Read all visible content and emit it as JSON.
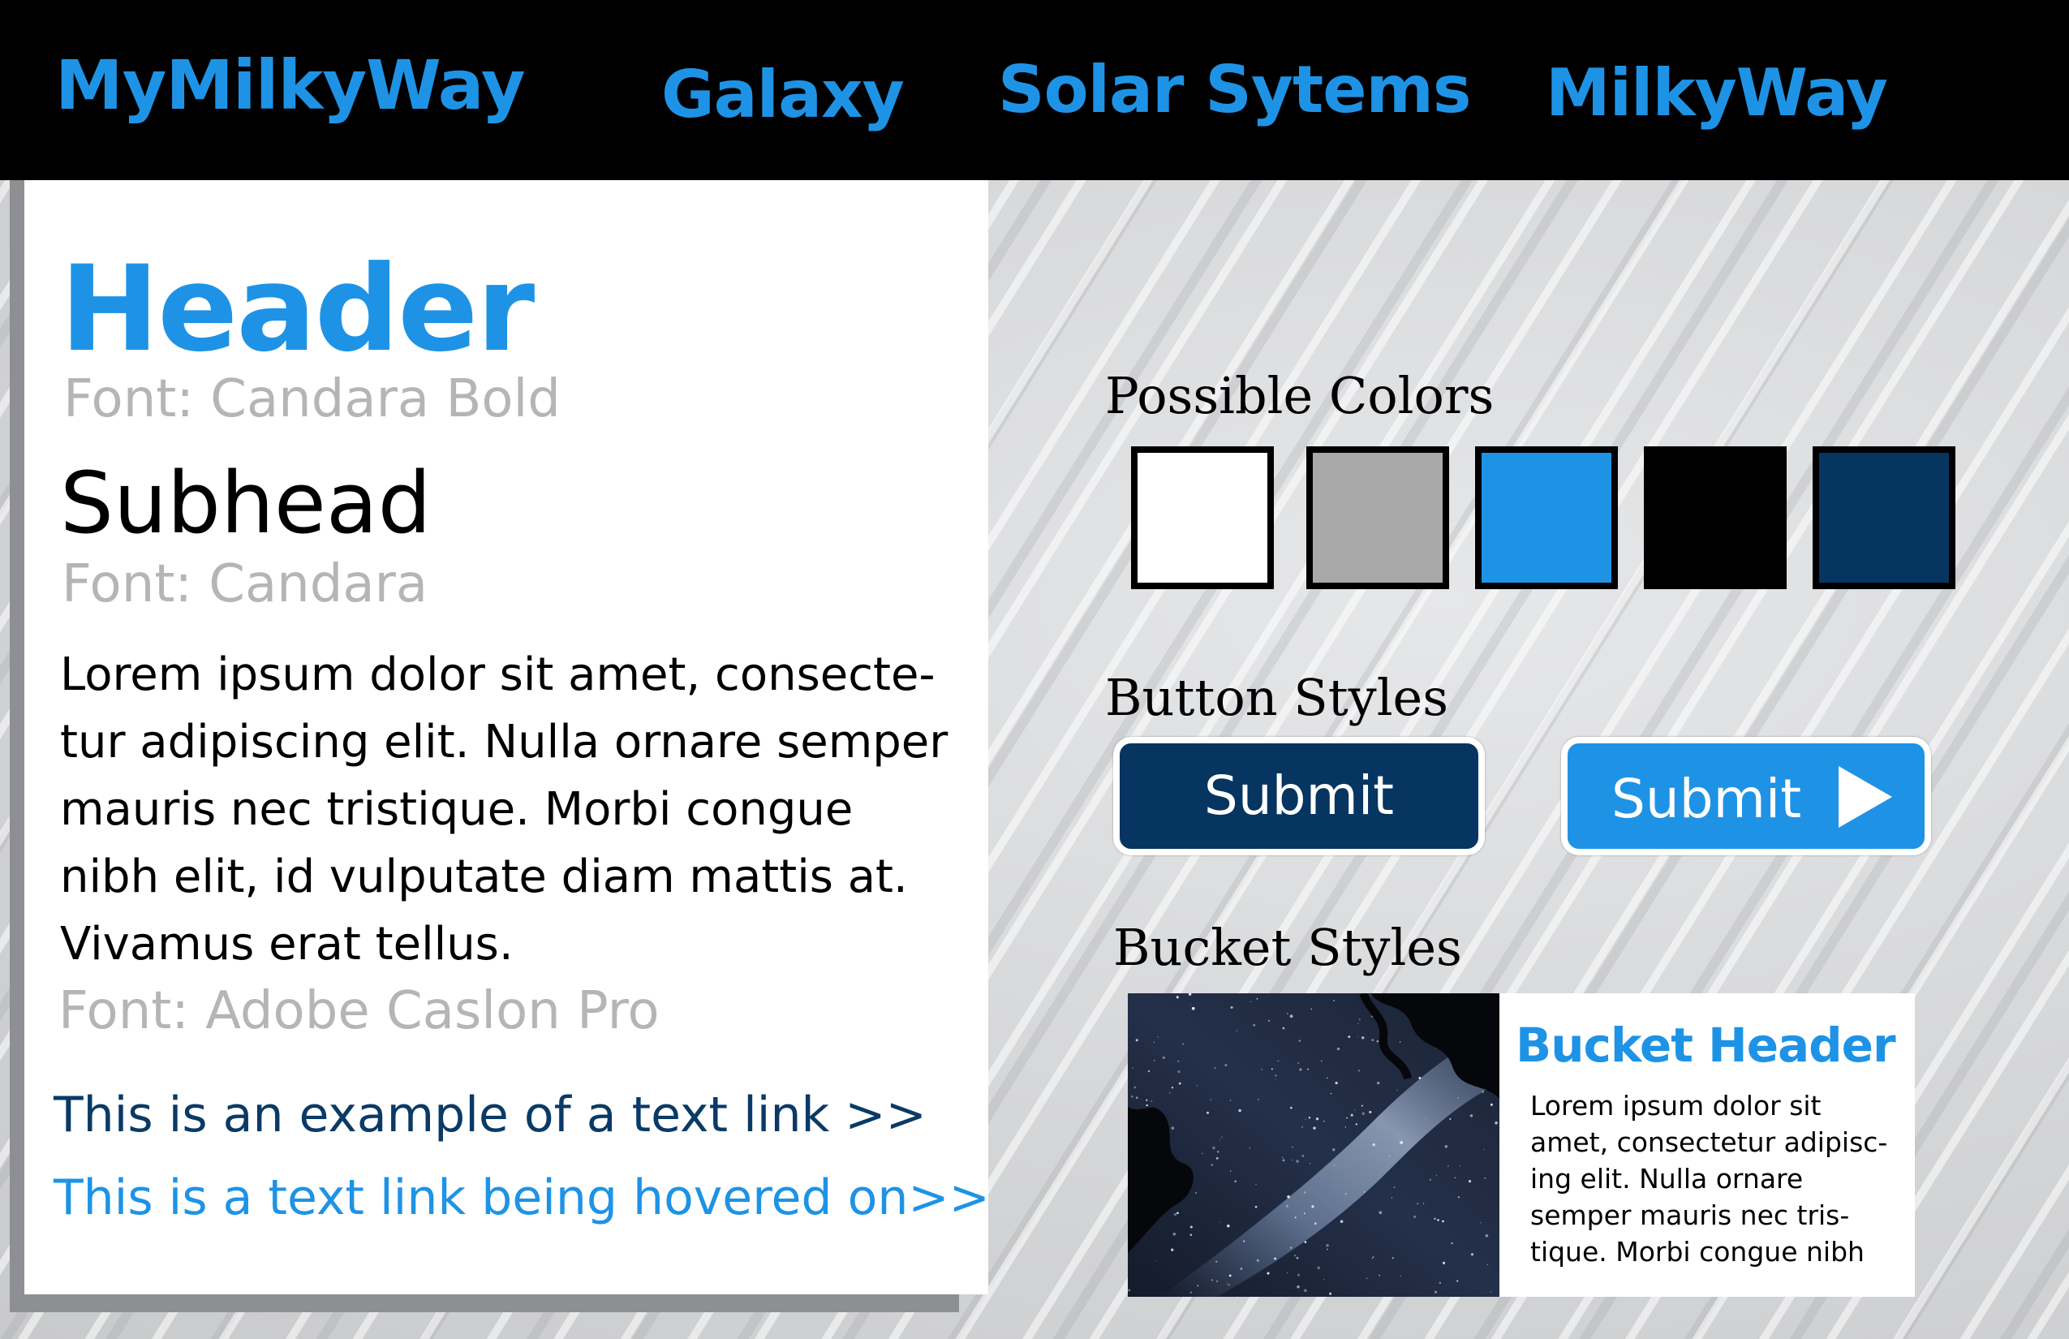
{
  "nav": {
    "brand": "MyMilkyWay",
    "items": [
      "Galaxy",
      "Solar Sytems",
      "MilkyWay"
    ]
  },
  "typography": {
    "header": "Header",
    "header_font": "Font: Candara Bold",
    "subhead": "Subhead",
    "subhead_font": "Font: Candara",
    "body_lines": [
      "Lorem ipsum dolor sit amet, consecte-",
      "tur adipiscing elit. Nulla ornare semper",
      "mauris nec tristique. Morbi congue",
      "nibh elit, id vulputate diam mattis at.",
      "Vivamus erat tellus."
    ],
    "body_font": "Font: Adobe Caslon Pro",
    "link_normal": "This is an example of a text link >>",
    "link_hover": "This is a text link being  hovered on>>"
  },
  "colors": {
    "label": "Possible Colors",
    "swatches": [
      "#ffffff",
      "#a9a9a9",
      "#1e93e6",
      "#000000",
      "#063561"
    ]
  },
  "buttons": {
    "label": "Button Styles",
    "primary_label": "Submit",
    "primary_color": "#063561",
    "arrow_label": "Submit",
    "arrow_color": "#1e93e6",
    "arrow_icon": "play-arrow-icon"
  },
  "bucket": {
    "label": "Bucket Styles",
    "image": "milky-way-night-sky",
    "title": "Bucket Header",
    "text_lines": [
      "Lorem ipsum dolor sit",
      "amet, consectetur adipisc-",
      "ing elit. Nulla ornare",
      "semper mauris nec tris-",
      "tique. Morbi congue nibh"
    ]
  },
  "accent_color": "#1e93e6",
  "dark_blue": "#0a3a66"
}
